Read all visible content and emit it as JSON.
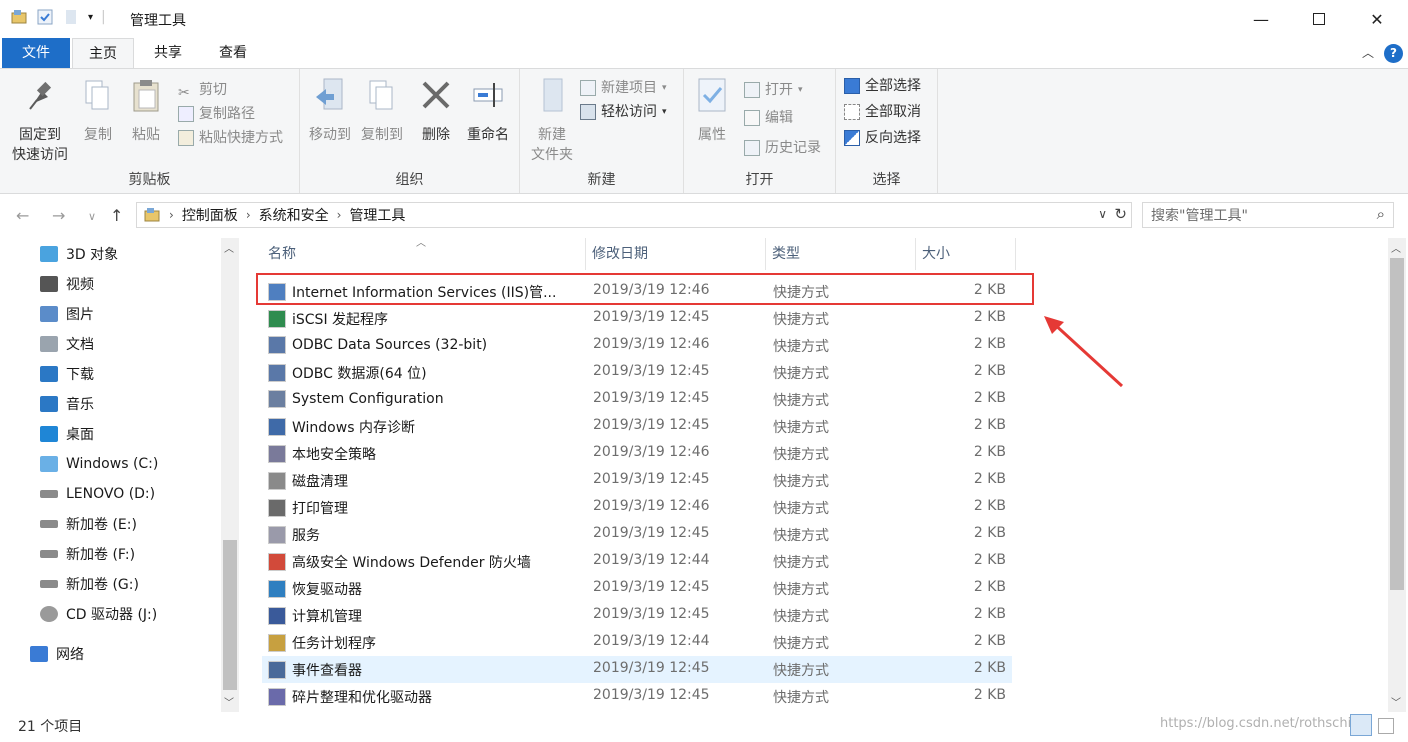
{
  "window": {
    "title": "管理工具"
  },
  "tabs": {
    "file": "文件",
    "home": "主页",
    "share": "共享",
    "view": "查看"
  },
  "ribbon": {
    "pin_line1": "固定到",
    "pin_line2": "快速访问",
    "copy": "复制",
    "paste": "粘贴",
    "cut": "剪切",
    "copy_path": "复制路径",
    "paste_shortcut": "粘贴快捷方式",
    "clipboard_label": "剪贴板",
    "move_to": "移动到",
    "copy_to": "复制到",
    "delete": "删除",
    "rename": "重命名",
    "organize_label": "组织",
    "new_folder_line1": "新建",
    "new_folder_line2": "文件夹",
    "new_item": "新建项目",
    "easy_access": "轻松访问",
    "new_label": "新建",
    "properties": "属性",
    "open": "打开",
    "edit": "编辑",
    "history": "历史记录",
    "open_label": "打开",
    "select_all": "全部选择",
    "select_none": "全部取消",
    "invert_selection": "反向选择",
    "select_label": "选择"
  },
  "address": {
    "crumbs": [
      "控制面板",
      "系统和安全",
      "管理工具"
    ]
  },
  "search": {
    "placeholder": "搜索\"管理工具\""
  },
  "sidebar": {
    "items": [
      {
        "label": "3D 对象",
        "icon": "3d-objects-icon"
      },
      {
        "label": "视频",
        "icon": "video-icon"
      },
      {
        "label": "图片",
        "icon": "pictures-icon"
      },
      {
        "label": "文档",
        "icon": "documents-icon"
      },
      {
        "label": "下载",
        "icon": "download-icon"
      },
      {
        "label": "音乐",
        "icon": "music-icon"
      },
      {
        "label": "桌面",
        "icon": "desktop-icon"
      },
      {
        "label": "Windows (C:)",
        "icon": "windows-drive-icon"
      },
      {
        "label": "LENOVO (D:)",
        "icon": "drive-icon"
      },
      {
        "label": "新加卷 (E:)",
        "icon": "drive-icon"
      },
      {
        "label": "新加卷 (F:)",
        "icon": "drive-icon"
      },
      {
        "label": "新加卷 (G:)",
        "icon": "drive-icon"
      },
      {
        "label": "CD 驱动器 (J:)",
        "icon": "cd-drive-icon"
      },
      {
        "label": "网络",
        "icon": "network-icon"
      }
    ]
  },
  "columns": {
    "name": "名称",
    "date": "修改日期",
    "type": "类型",
    "size": "大小"
  },
  "files": [
    {
      "name": "Internet Information Services (IIS)管...",
      "date": "2019/3/19 12:46",
      "type": "快捷方式",
      "size": "2 KB"
    },
    {
      "name": "iSCSI 发起程序",
      "date": "2019/3/19 12:45",
      "type": "快捷方式",
      "size": "2 KB"
    },
    {
      "name": "ODBC Data Sources (32-bit)",
      "date": "2019/3/19 12:46",
      "type": "快捷方式",
      "size": "2 KB"
    },
    {
      "name": "ODBC 数据源(64 位)",
      "date": "2019/3/19 12:45",
      "type": "快捷方式",
      "size": "2 KB"
    },
    {
      "name": "System Configuration",
      "date": "2019/3/19 12:45",
      "type": "快捷方式",
      "size": "2 KB"
    },
    {
      "name": "Windows 内存诊断",
      "date": "2019/3/19 12:45",
      "type": "快捷方式",
      "size": "2 KB"
    },
    {
      "name": "本地安全策略",
      "date": "2019/3/19 12:46",
      "type": "快捷方式",
      "size": "2 KB"
    },
    {
      "name": "磁盘清理",
      "date": "2019/3/19 12:45",
      "type": "快捷方式",
      "size": "2 KB"
    },
    {
      "name": "打印管理",
      "date": "2019/3/19 12:46",
      "type": "快捷方式",
      "size": "2 KB"
    },
    {
      "name": "服务",
      "date": "2019/3/19 12:45",
      "type": "快捷方式",
      "size": "2 KB"
    },
    {
      "name": "高级安全 Windows Defender 防火墙",
      "date": "2019/3/19 12:44",
      "type": "快捷方式",
      "size": "2 KB"
    },
    {
      "name": "恢复驱动器",
      "date": "2019/3/19 12:45",
      "type": "快捷方式",
      "size": "2 KB"
    },
    {
      "name": "计算机管理",
      "date": "2019/3/19 12:45",
      "type": "快捷方式",
      "size": "2 KB"
    },
    {
      "name": "任务计划程序",
      "date": "2019/3/19 12:44",
      "type": "快捷方式",
      "size": "2 KB"
    },
    {
      "name": "事件查看器",
      "date": "2019/3/19 12:45",
      "type": "快捷方式",
      "size": "2 KB"
    },
    {
      "name": "碎片整理和优化驱动器",
      "date": "2019/3/19 12:45",
      "type": "快捷方式",
      "size": "2 KB"
    }
  ],
  "status": {
    "count": "21 个项目"
  },
  "watermark": "https://blog.csdn.net/rothschild"
}
